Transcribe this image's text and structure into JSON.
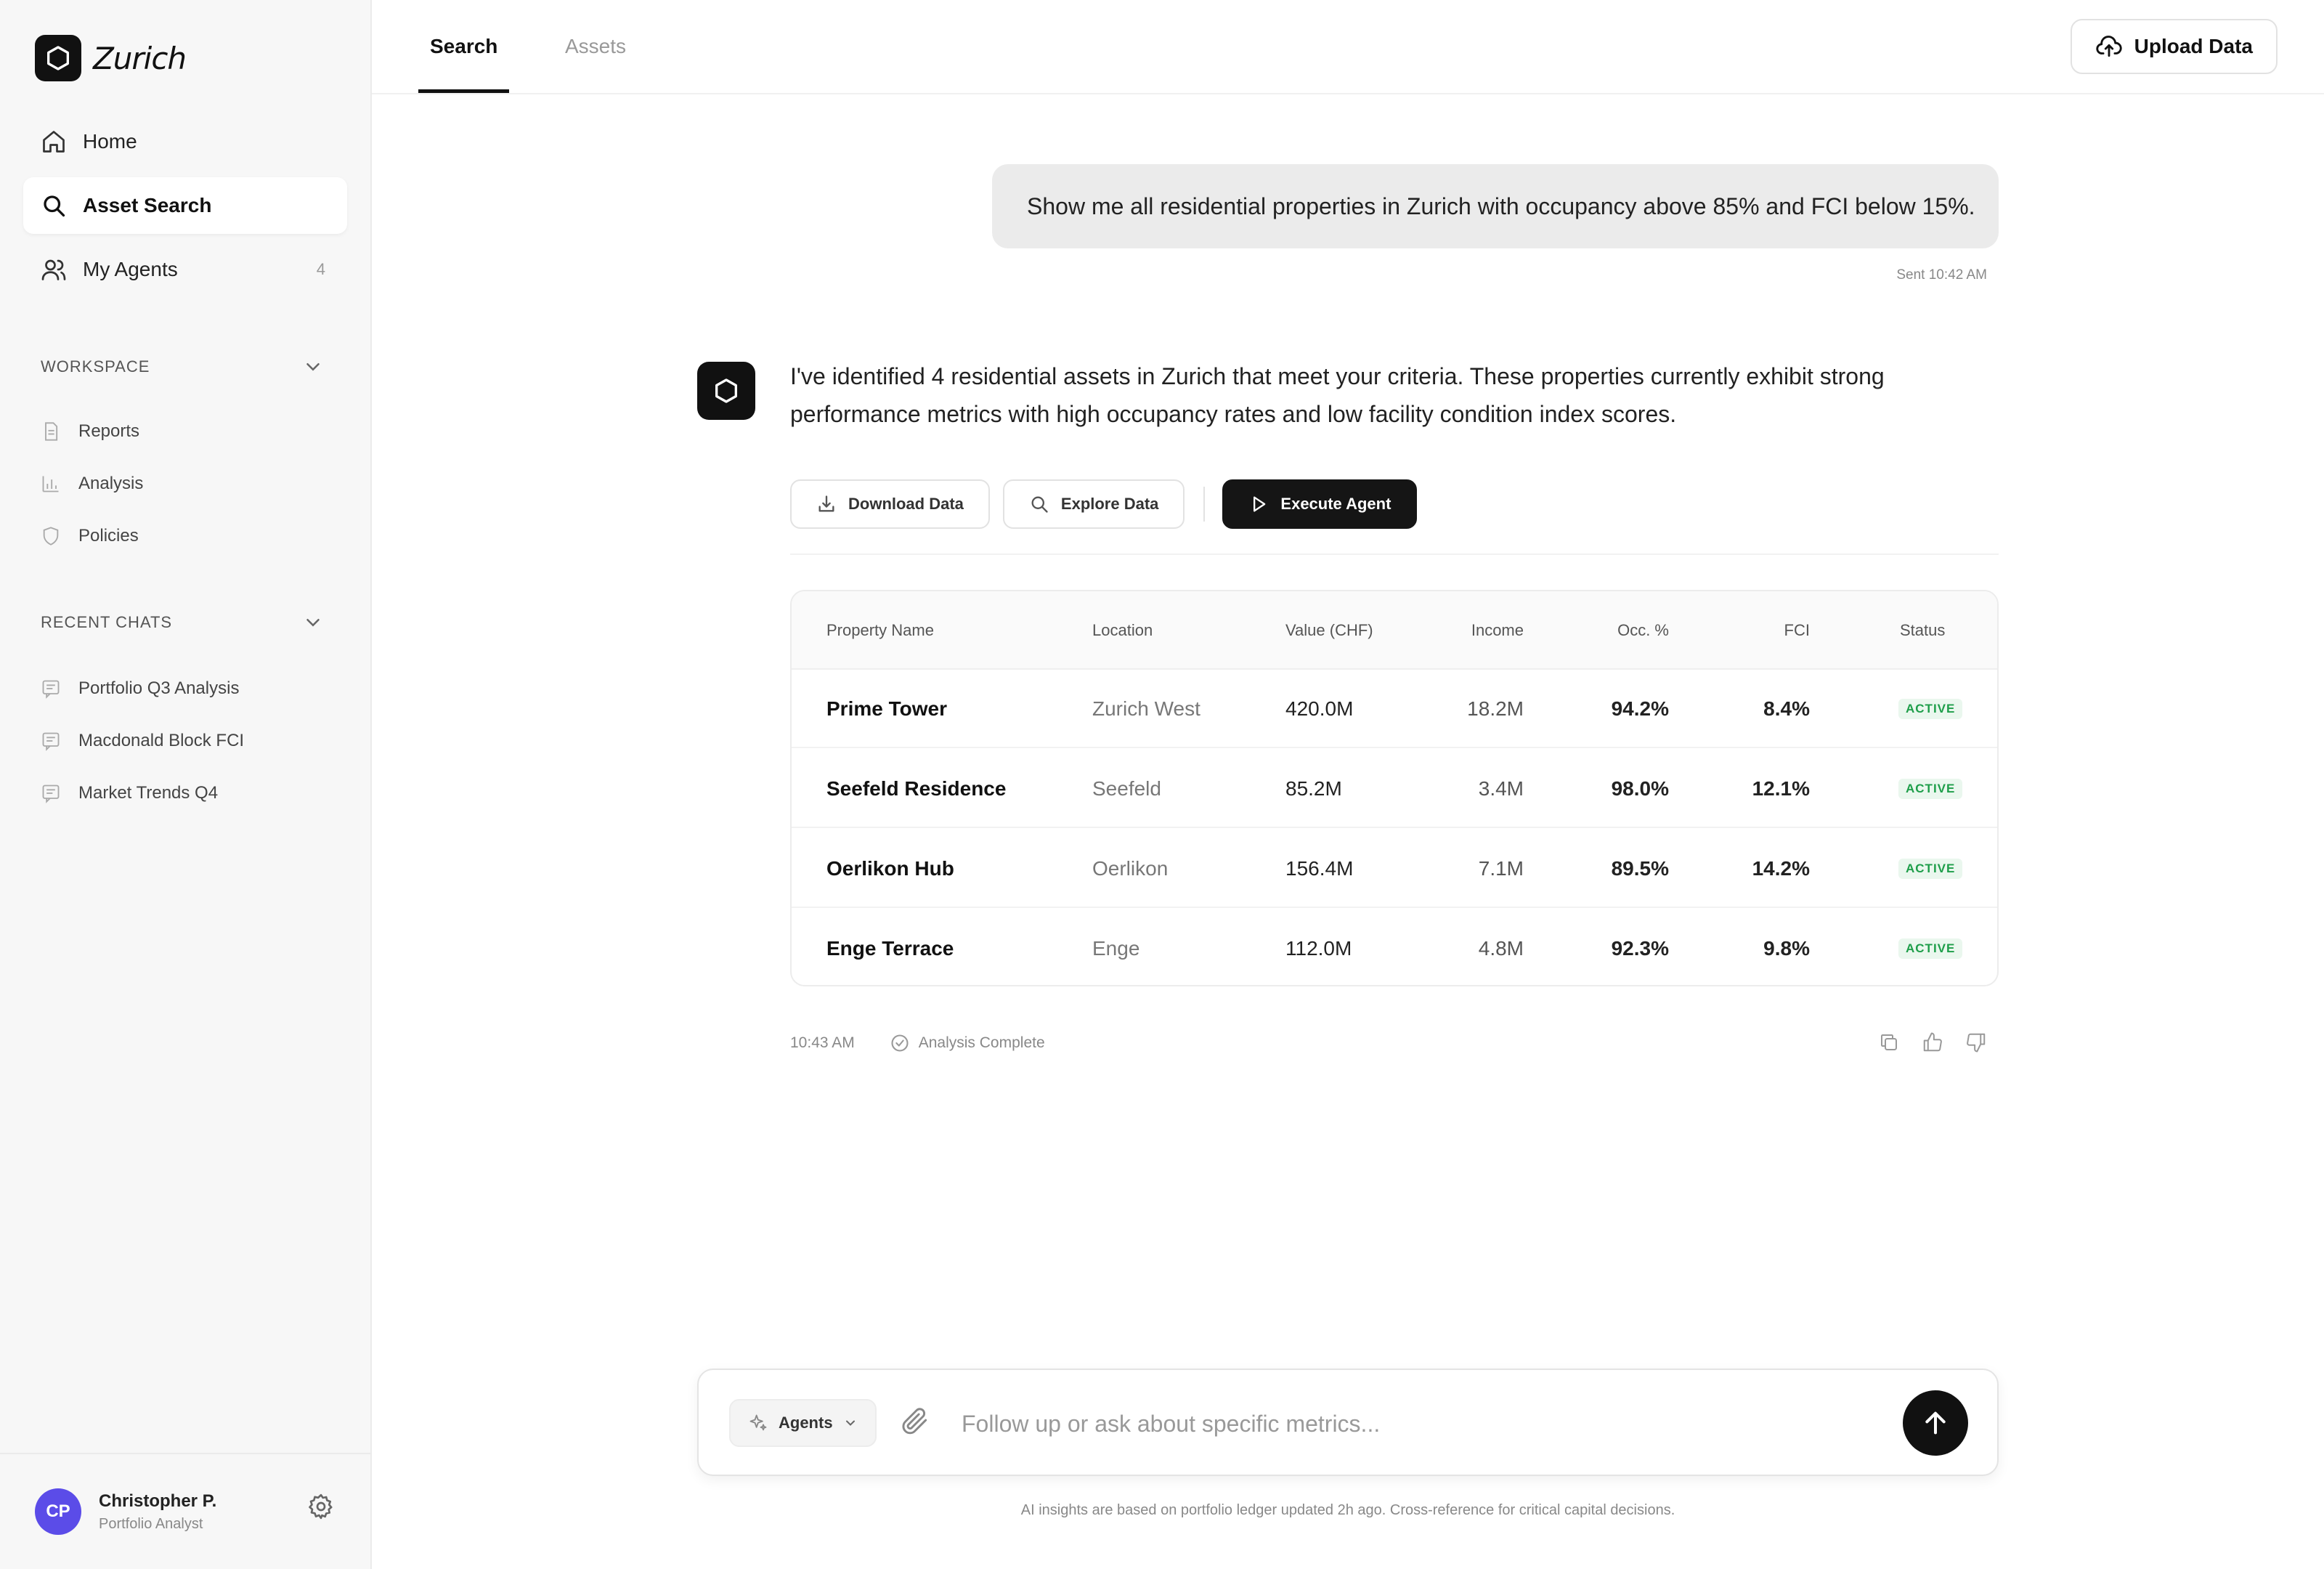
{
  "app": {
    "name": "Zurich"
  },
  "sidebar": {
    "nav": [
      {
        "label": "Home",
        "icon": "home-icon"
      },
      {
        "label": "Asset Search",
        "icon": "search-icon",
        "active": true
      },
      {
        "label": "My Agents",
        "icon": "users-icon",
        "badge": "4"
      }
    ],
    "workspace": {
      "title": "WORKSPACE",
      "items": [
        {
          "label": "Reports",
          "icon": "document-icon"
        },
        {
          "label": "Analysis",
          "icon": "bar-chart-icon"
        },
        {
          "label": "Policies",
          "icon": "shield-icon"
        }
      ]
    },
    "recent": {
      "title": "RECENT CHATS",
      "items": [
        {
          "label": "Portfolio Q3 Analysis",
          "icon": "chat-icon"
        },
        {
          "label": "Macdonald Block FCI",
          "icon": "chat-icon"
        },
        {
          "label": "Market Trends Q4",
          "icon": "chat-icon"
        }
      ]
    },
    "user": {
      "initials": "CP",
      "name": "Christopher P.",
      "role": "Portfolio Analyst",
      "avatar_color": "#5b4ce8"
    }
  },
  "header": {
    "tabs": [
      {
        "label": "Search",
        "active": true
      },
      {
        "label": "Assets"
      }
    ],
    "upload_label": "Upload Data"
  },
  "chat": {
    "user_message": "Show me all residential properties in Zurich with occupancy above 85% and FCI below 15%.",
    "sent_time": "Sent 10:42 AM",
    "bot_message": "I've identified 4 residential assets in Zurich that meet your criteria. These properties currently exhibit strong performance metrics with high occupancy rates and low facility condition index scores.",
    "actions": {
      "download": "Download Data",
      "explore": "Explore Data",
      "execute": "Execute Agent"
    },
    "table": {
      "headers": {
        "name": "Property Name",
        "location": "Location",
        "value": "Value (CHF)",
        "income": "Income",
        "occupancy": "Occ. %",
        "fci": "FCI",
        "status": "Status"
      },
      "rows": [
        {
          "name": "Prime Tower",
          "location": "Zurich West",
          "value": "420.0M",
          "income": "18.2M",
          "occupancy": "94.2%",
          "fci": "8.4%",
          "status": "ACTIVE"
        },
        {
          "name": "Seefeld Residence",
          "location": "Seefeld",
          "value": "85.2M",
          "income": "3.4M",
          "occupancy": "98.0%",
          "fci": "12.1%",
          "status": "ACTIVE"
        },
        {
          "name": "Oerlikon Hub",
          "location": "Oerlikon",
          "value": "156.4M",
          "income": "7.1M",
          "occupancy": "89.5%",
          "fci": "14.2%",
          "status": "ACTIVE"
        },
        {
          "name": "Enge Terrace",
          "location": "Enge",
          "value": "112.0M",
          "income": "4.8M",
          "occupancy": "92.3%",
          "fci": "9.8%",
          "status": "ACTIVE"
        }
      ]
    },
    "reply_time": "10:43 AM",
    "reply_status": "Analysis Complete"
  },
  "composer": {
    "agents_label": "Agents",
    "placeholder": "Follow up or ask about specific metrics...",
    "disclaimer": "AI insights are based on portfolio ledger updated 2h ago. Cross-reference for critical capital decisions."
  },
  "colors": {
    "accent": "#111111",
    "status_green": "#1e9e4a",
    "avatar": "#5b4ce8"
  }
}
